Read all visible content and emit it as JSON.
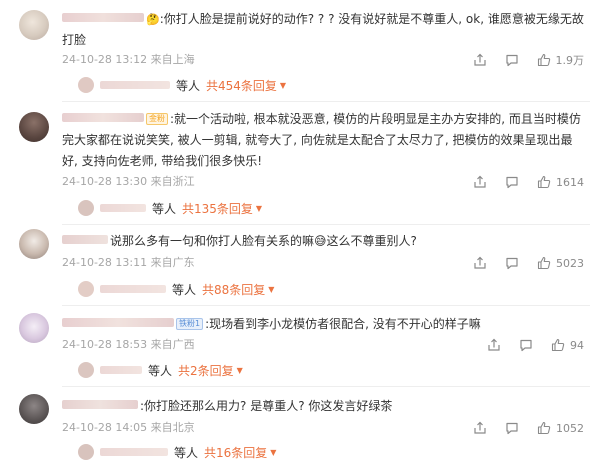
{
  "comments": [
    {
      "badge": "",
      "text": ":你打人脸是提前说好的动作? ? ? 没有说好就是不尊重人, ok, 谁愿意被无缘无故打脸",
      "meta": "24-10-28 13:12 来自上海",
      "likes": "1.9万",
      "reply_who": "等人",
      "reply_link": "共454条回复",
      "avatar_color": "#d7cbbf"
    },
    {
      "badge": "金粉",
      "text": ":就一个活动啦, 根本就没恶意, 模仿的片段明显是主办方安排的, 而且当时模仿完大家都在说说笑笑, 被人一剪辑, 就夸大了, 向佐就是太配合了太尽力了, 把模仿的效果呈现出最好, 支持向佐老师, 带给我们很多快乐!",
      "meta": "24-10-28 13:30 来自浙江",
      "likes": "1614",
      "reply_who": "等人",
      "reply_link": "共135条回复",
      "avatar_color": "#6d5a52"
    },
    {
      "badge": "",
      "text": "说那么多有一句和你打人脸有关系的嘛😅这么不尊重别人?",
      "meta": "24-10-28 13:11 来自广东",
      "likes": "5023",
      "reply_who": "等人",
      "reply_link": "共88条回复",
      "avatar_color": "#c9b9ae"
    },
    {
      "badge": "铁粉1",
      "text": ":现场看到李小龙模仿者很配合, 没有不开心的样子嘛",
      "meta": "24-10-28 18:53 来自广西",
      "likes": "94",
      "reply_who": "等人",
      "reply_link": "共2条回复",
      "avatar_color": "#d9c8df"
    },
    {
      "badge": "",
      "text": ":你打脸还那么用力? 是尊重人? 你这发言好绿茶",
      "meta": "24-10-28 14:05 来自北京",
      "likes": "1052",
      "reply_who": "等人",
      "reply_link": "共16条回复",
      "avatar_color": "#5a5454"
    }
  ],
  "colors": {
    "text": "#333333",
    "meta": "#a6a6a6",
    "reply_link": "#eb7340",
    "badge_gold": "#f5a623",
    "badge_fan": "#5b8fd6",
    "blurred_name": "#e7d2cf"
  },
  "icons": [
    "share-icon",
    "comment-icon",
    "like-icon",
    "chevron-down-icon"
  ]
}
